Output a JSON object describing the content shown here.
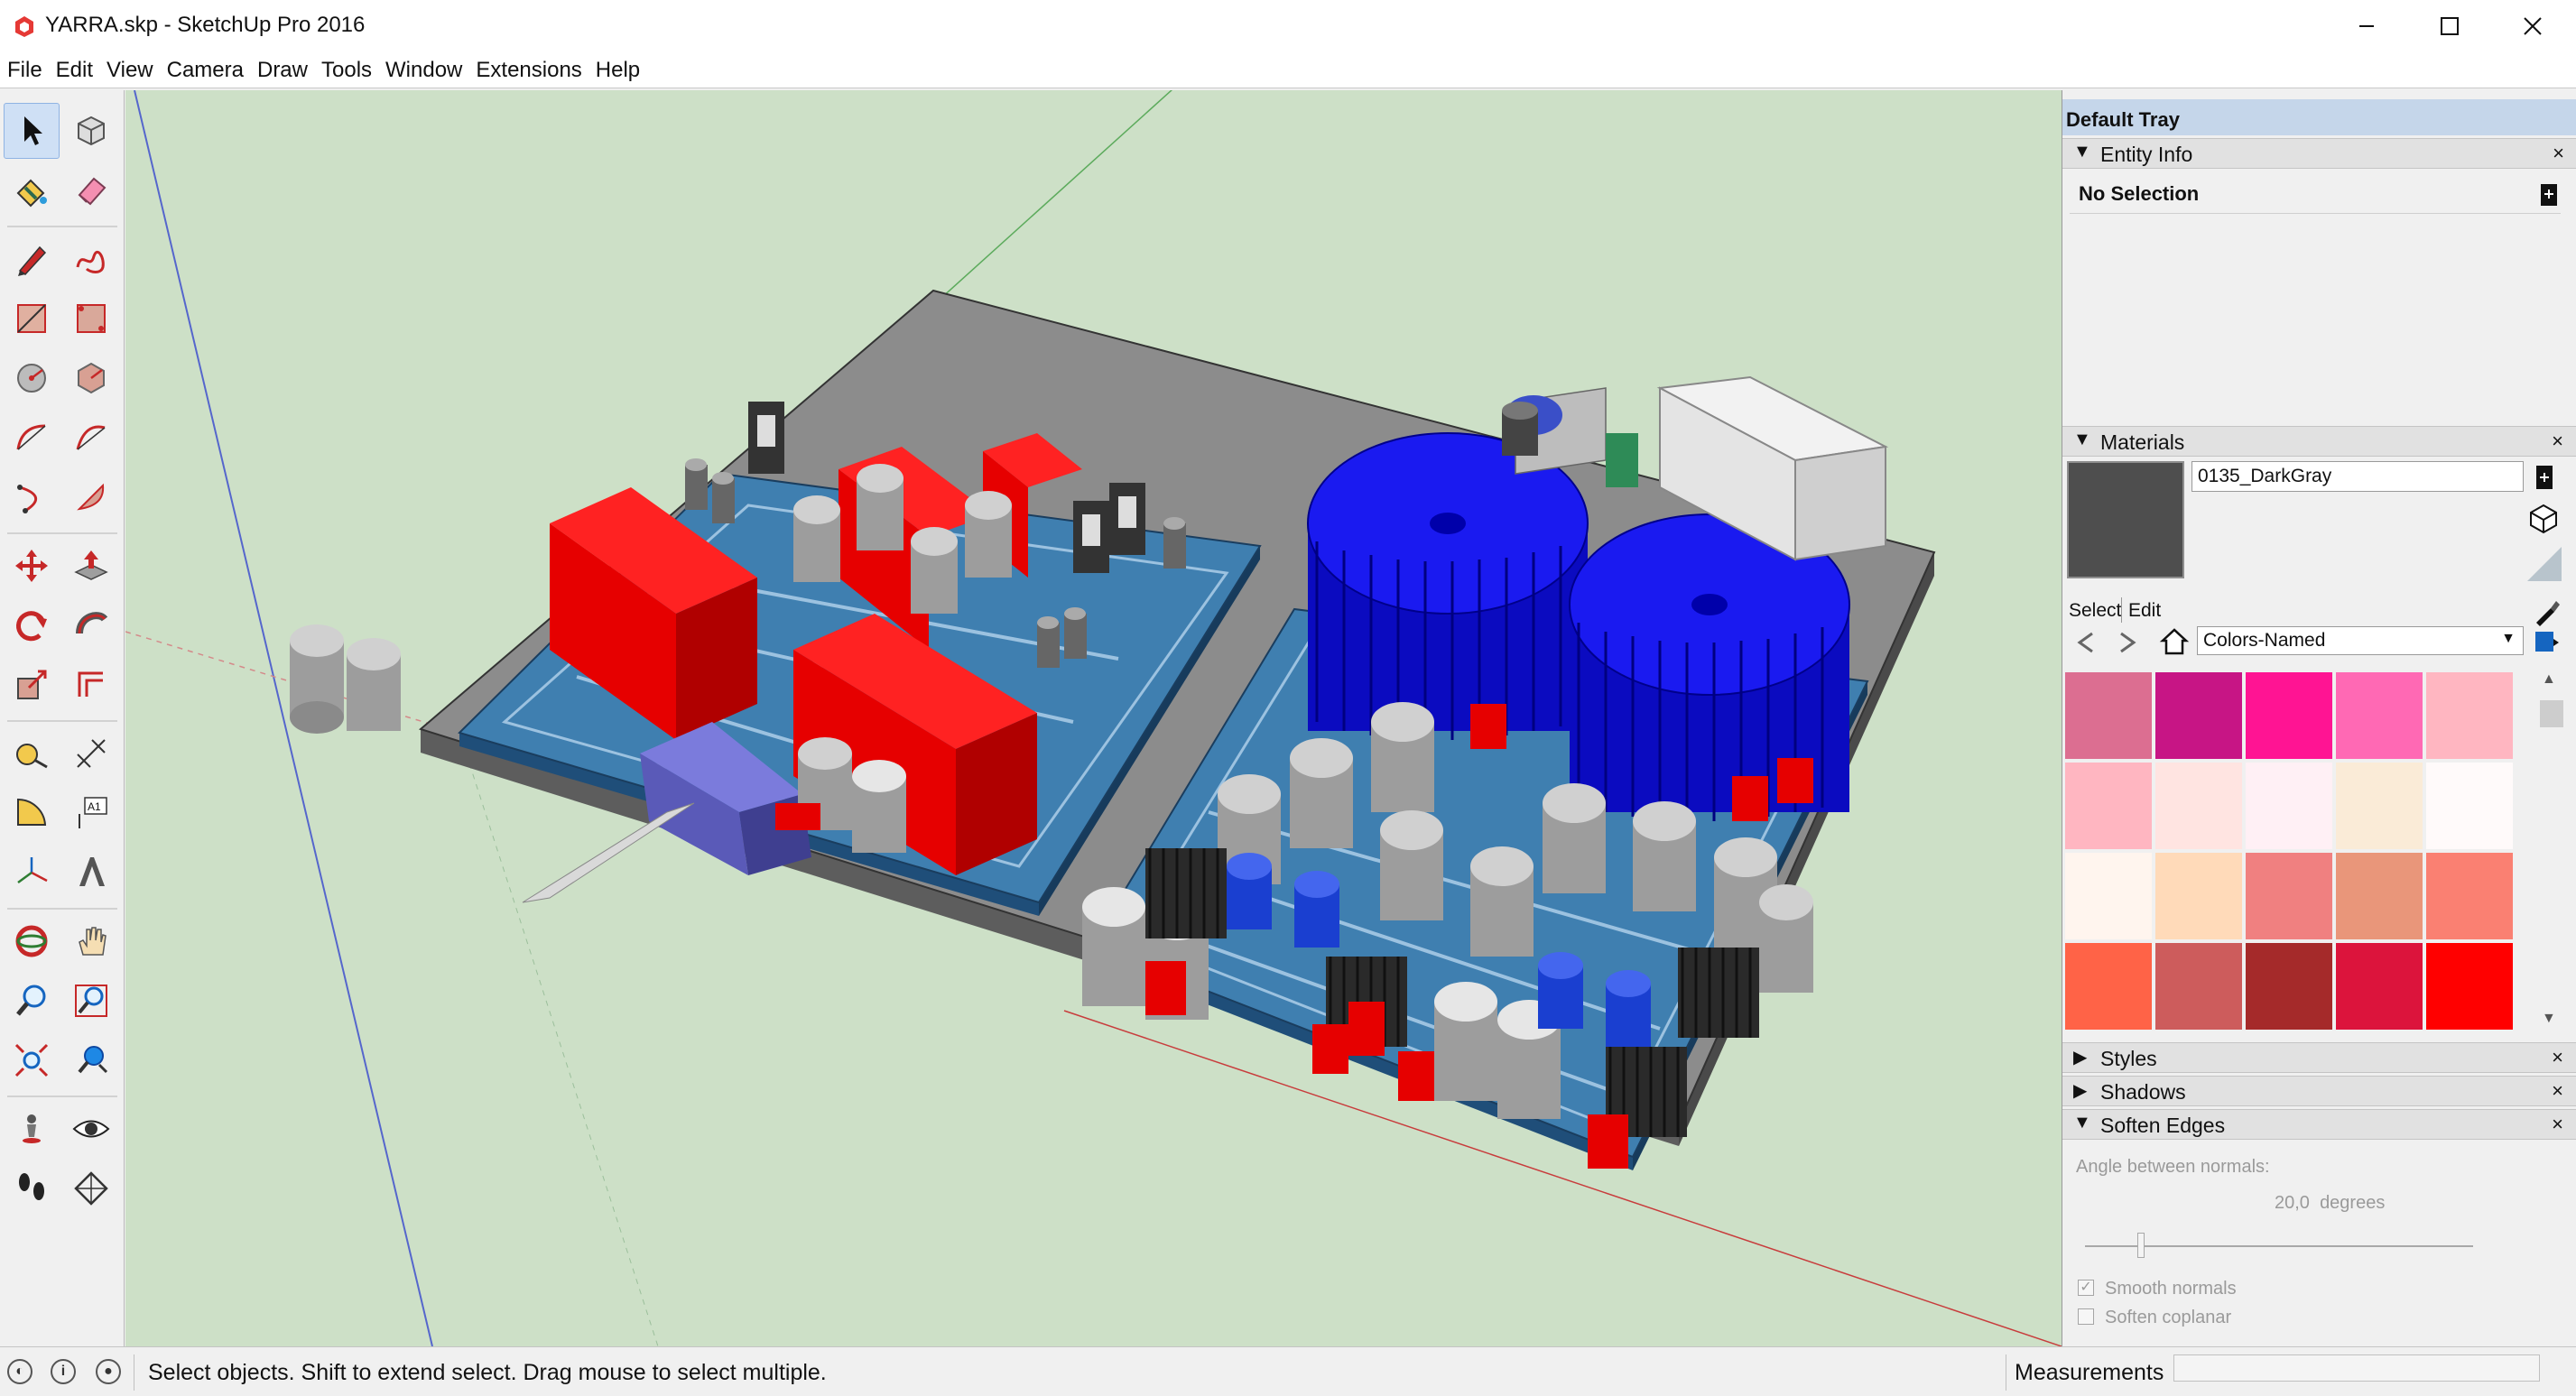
{
  "window": {
    "title": "YARRA.skp - SketchUp Pro 2016"
  },
  "menu": [
    "File",
    "Edit",
    "View",
    "Camera",
    "Draw",
    "Tools",
    "Window",
    "Extensions",
    "Help"
  ],
  "toolbar": {
    "tools": [
      {
        "name": "select-tool",
        "icon": "arrow-cursor-icon"
      },
      {
        "name": "make-component-tool",
        "icon": "component-box-icon"
      },
      {
        "name": "paint-bucket-tool",
        "icon": "paint-bucket-icon"
      },
      {
        "name": "eraser-tool",
        "icon": "eraser-icon"
      },
      {
        "name": "line-tool",
        "icon": "pencil-icon"
      },
      {
        "name": "freehand-tool",
        "icon": "freehand-icon"
      },
      {
        "name": "rectangle-tool",
        "icon": "rectangle-icon"
      },
      {
        "name": "rotated-rectangle-tool",
        "icon": "rotated-rectangle-icon"
      },
      {
        "name": "circle-tool",
        "icon": "circle-icon"
      },
      {
        "name": "polygon-tool",
        "icon": "polygon-icon"
      },
      {
        "name": "arc-tool",
        "icon": "arc-icon"
      },
      {
        "name": "two-point-arc-tool",
        "icon": "two-point-arc-icon"
      },
      {
        "name": "three-point-arc-tool",
        "icon": "three-point-arc-icon"
      },
      {
        "name": "pie-tool",
        "icon": "pie-icon"
      },
      {
        "name": "move-tool",
        "icon": "move-icon"
      },
      {
        "name": "push-pull-tool",
        "icon": "push-pull-icon"
      },
      {
        "name": "rotate-tool",
        "icon": "rotate-icon"
      },
      {
        "name": "follow-me-tool",
        "icon": "follow-me-icon"
      },
      {
        "name": "scale-tool",
        "icon": "scale-icon"
      },
      {
        "name": "offset-tool",
        "icon": "offset-icon"
      },
      {
        "name": "tape-measure-tool",
        "icon": "tape-measure-icon"
      },
      {
        "name": "dimension-tool",
        "icon": "dimension-icon"
      },
      {
        "name": "protractor-tool",
        "icon": "protractor-icon"
      },
      {
        "name": "text-tool",
        "icon": "text-label-icon"
      },
      {
        "name": "axes-tool",
        "icon": "axes-icon"
      },
      {
        "name": "3d-text-tool",
        "icon": "3d-text-icon"
      },
      {
        "name": "orbit-tool",
        "icon": "orbit-icon"
      },
      {
        "name": "pan-tool",
        "icon": "hand-icon"
      },
      {
        "name": "zoom-tool",
        "icon": "magnifier-icon"
      },
      {
        "name": "zoom-window-tool",
        "icon": "zoom-window-icon"
      },
      {
        "name": "zoom-extents-tool",
        "icon": "zoom-extents-icon"
      },
      {
        "name": "previous-view-tool",
        "icon": "previous-view-icon"
      },
      {
        "name": "position-camera-tool",
        "icon": "position-camera-icon"
      },
      {
        "name": "look-around-tool",
        "icon": "eye-icon"
      },
      {
        "name": "walk-tool",
        "icon": "footprints-icon"
      },
      {
        "name": "section-plane-tool",
        "icon": "section-plane-icon"
      }
    ],
    "text_tool_glyph": "A1"
  },
  "tray": {
    "title": "Default Tray",
    "entity_info": {
      "title": "Entity Info",
      "value": "No Selection"
    },
    "materials": {
      "title": "Materials",
      "current_name": "0135_DarkGray",
      "current_color": "#4e4e4e",
      "tab_select": "Select",
      "tab_edit": "Edit",
      "library": "Colors-Named",
      "swatches": [
        "#dc6e91",
        "#c71585",
        "#ff1493",
        "#ff69b4",
        "#ffb6c1",
        "#ffb6c1",
        "#ffe4e1",
        "#fff0f5",
        "#faebd7",
        "#fffafa",
        "#fff5ee",
        "#ffdab9",
        "#f08080",
        "#e9967a",
        "#fa8072",
        "#ff6347",
        "#cd5c5c",
        "#a52a2a",
        "#dc143c",
        "#ff0000"
      ]
    },
    "styles": {
      "title": "Styles"
    },
    "shadows": {
      "title": "Shadows"
    },
    "soften_edges": {
      "title": "Soften Edges",
      "angle_label": "Angle between normals:",
      "angle_value": "20,0",
      "angle_unit": "degrees",
      "smooth_normals": "Smooth normals",
      "soften_coplanar": "Soften coplanar",
      "smooth_checked": true,
      "coplanar_checked": false
    }
  },
  "status": {
    "message": "Select objects. Shift to extend select. Drag mouse to select multiple.",
    "measurements_label": "Measurements"
  },
  "colors": {
    "viewport_bg": "#cde0c7",
    "board_gray": "#8c8c8c",
    "pcb_blue": "#3f7fb0",
    "transformer_blue": "#1212e0",
    "capacitor_red": "#e60000",
    "tray_header": "#c5d6ea"
  }
}
